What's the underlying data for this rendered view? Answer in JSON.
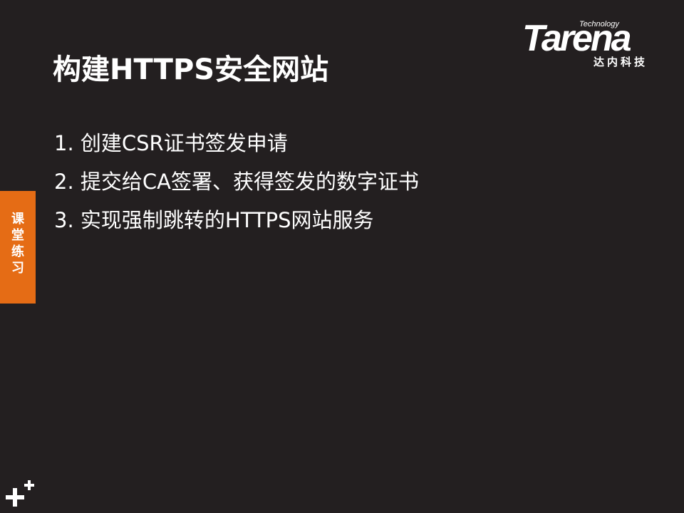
{
  "slide": {
    "title": "构建HTTPS安全网站",
    "items": [
      "1. 创建CSR证书签发申请",
      "2. 提交给CA签署、获得签发的数字证书",
      "3. 实现强制跳转的HTTPS网站服务"
    ]
  },
  "side_tab": {
    "label_lines": [
      "课",
      "堂",
      "练",
      "习"
    ]
  },
  "logo": {
    "tagline": "Technology",
    "brand": "Tarena",
    "chinese": "达内科技"
  },
  "colors": {
    "background": "#231f20",
    "accent": "#e56c15",
    "text": "#ffffff"
  },
  "icons": {
    "corner": "plus-icon"
  }
}
